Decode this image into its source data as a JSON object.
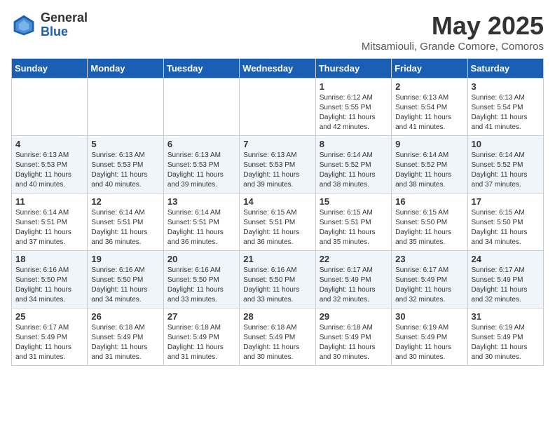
{
  "header": {
    "logo_general": "General",
    "logo_blue": "Blue",
    "month_year": "May 2025",
    "location": "Mitsamiouli, Grande Comore, Comoros"
  },
  "days_of_week": [
    "Sunday",
    "Monday",
    "Tuesday",
    "Wednesday",
    "Thursday",
    "Friday",
    "Saturday"
  ],
  "weeks": [
    [
      {
        "day": "",
        "info": ""
      },
      {
        "day": "",
        "info": ""
      },
      {
        "day": "",
        "info": ""
      },
      {
        "day": "",
        "info": ""
      },
      {
        "day": "1",
        "info": "Sunrise: 6:12 AM\nSunset: 5:55 PM\nDaylight: 11 hours\nand 42 minutes."
      },
      {
        "day": "2",
        "info": "Sunrise: 6:13 AM\nSunset: 5:54 PM\nDaylight: 11 hours\nand 41 minutes."
      },
      {
        "day": "3",
        "info": "Sunrise: 6:13 AM\nSunset: 5:54 PM\nDaylight: 11 hours\nand 41 minutes."
      }
    ],
    [
      {
        "day": "4",
        "info": "Sunrise: 6:13 AM\nSunset: 5:53 PM\nDaylight: 11 hours\nand 40 minutes."
      },
      {
        "day": "5",
        "info": "Sunrise: 6:13 AM\nSunset: 5:53 PM\nDaylight: 11 hours\nand 40 minutes."
      },
      {
        "day": "6",
        "info": "Sunrise: 6:13 AM\nSunset: 5:53 PM\nDaylight: 11 hours\nand 39 minutes."
      },
      {
        "day": "7",
        "info": "Sunrise: 6:13 AM\nSunset: 5:53 PM\nDaylight: 11 hours\nand 39 minutes."
      },
      {
        "day": "8",
        "info": "Sunrise: 6:14 AM\nSunset: 5:52 PM\nDaylight: 11 hours\nand 38 minutes."
      },
      {
        "day": "9",
        "info": "Sunrise: 6:14 AM\nSunset: 5:52 PM\nDaylight: 11 hours\nand 38 minutes."
      },
      {
        "day": "10",
        "info": "Sunrise: 6:14 AM\nSunset: 5:52 PM\nDaylight: 11 hours\nand 37 minutes."
      }
    ],
    [
      {
        "day": "11",
        "info": "Sunrise: 6:14 AM\nSunset: 5:51 PM\nDaylight: 11 hours\nand 37 minutes."
      },
      {
        "day": "12",
        "info": "Sunrise: 6:14 AM\nSunset: 5:51 PM\nDaylight: 11 hours\nand 36 minutes."
      },
      {
        "day": "13",
        "info": "Sunrise: 6:14 AM\nSunset: 5:51 PM\nDaylight: 11 hours\nand 36 minutes."
      },
      {
        "day": "14",
        "info": "Sunrise: 6:15 AM\nSunset: 5:51 PM\nDaylight: 11 hours\nand 36 minutes."
      },
      {
        "day": "15",
        "info": "Sunrise: 6:15 AM\nSunset: 5:51 PM\nDaylight: 11 hours\nand 35 minutes."
      },
      {
        "day": "16",
        "info": "Sunrise: 6:15 AM\nSunset: 5:50 PM\nDaylight: 11 hours\nand 35 minutes."
      },
      {
        "day": "17",
        "info": "Sunrise: 6:15 AM\nSunset: 5:50 PM\nDaylight: 11 hours\nand 34 minutes."
      }
    ],
    [
      {
        "day": "18",
        "info": "Sunrise: 6:16 AM\nSunset: 5:50 PM\nDaylight: 11 hours\nand 34 minutes."
      },
      {
        "day": "19",
        "info": "Sunrise: 6:16 AM\nSunset: 5:50 PM\nDaylight: 11 hours\nand 34 minutes."
      },
      {
        "day": "20",
        "info": "Sunrise: 6:16 AM\nSunset: 5:50 PM\nDaylight: 11 hours\nand 33 minutes."
      },
      {
        "day": "21",
        "info": "Sunrise: 6:16 AM\nSunset: 5:50 PM\nDaylight: 11 hours\nand 33 minutes."
      },
      {
        "day": "22",
        "info": "Sunrise: 6:17 AM\nSunset: 5:49 PM\nDaylight: 11 hours\nand 32 minutes."
      },
      {
        "day": "23",
        "info": "Sunrise: 6:17 AM\nSunset: 5:49 PM\nDaylight: 11 hours\nand 32 minutes."
      },
      {
        "day": "24",
        "info": "Sunrise: 6:17 AM\nSunset: 5:49 PM\nDaylight: 11 hours\nand 32 minutes."
      }
    ],
    [
      {
        "day": "25",
        "info": "Sunrise: 6:17 AM\nSunset: 5:49 PM\nDaylight: 11 hours\nand 31 minutes."
      },
      {
        "day": "26",
        "info": "Sunrise: 6:18 AM\nSunset: 5:49 PM\nDaylight: 11 hours\nand 31 minutes."
      },
      {
        "day": "27",
        "info": "Sunrise: 6:18 AM\nSunset: 5:49 PM\nDaylight: 11 hours\nand 31 minutes."
      },
      {
        "day": "28",
        "info": "Sunrise: 6:18 AM\nSunset: 5:49 PM\nDaylight: 11 hours\nand 30 minutes."
      },
      {
        "day": "29",
        "info": "Sunrise: 6:18 AM\nSunset: 5:49 PM\nDaylight: 11 hours\nand 30 minutes."
      },
      {
        "day": "30",
        "info": "Sunrise: 6:19 AM\nSunset: 5:49 PM\nDaylight: 11 hours\nand 30 minutes."
      },
      {
        "day": "31",
        "info": "Sunrise: 6:19 AM\nSunset: 5:49 PM\nDaylight: 11 hours\nand 30 minutes."
      }
    ]
  ]
}
